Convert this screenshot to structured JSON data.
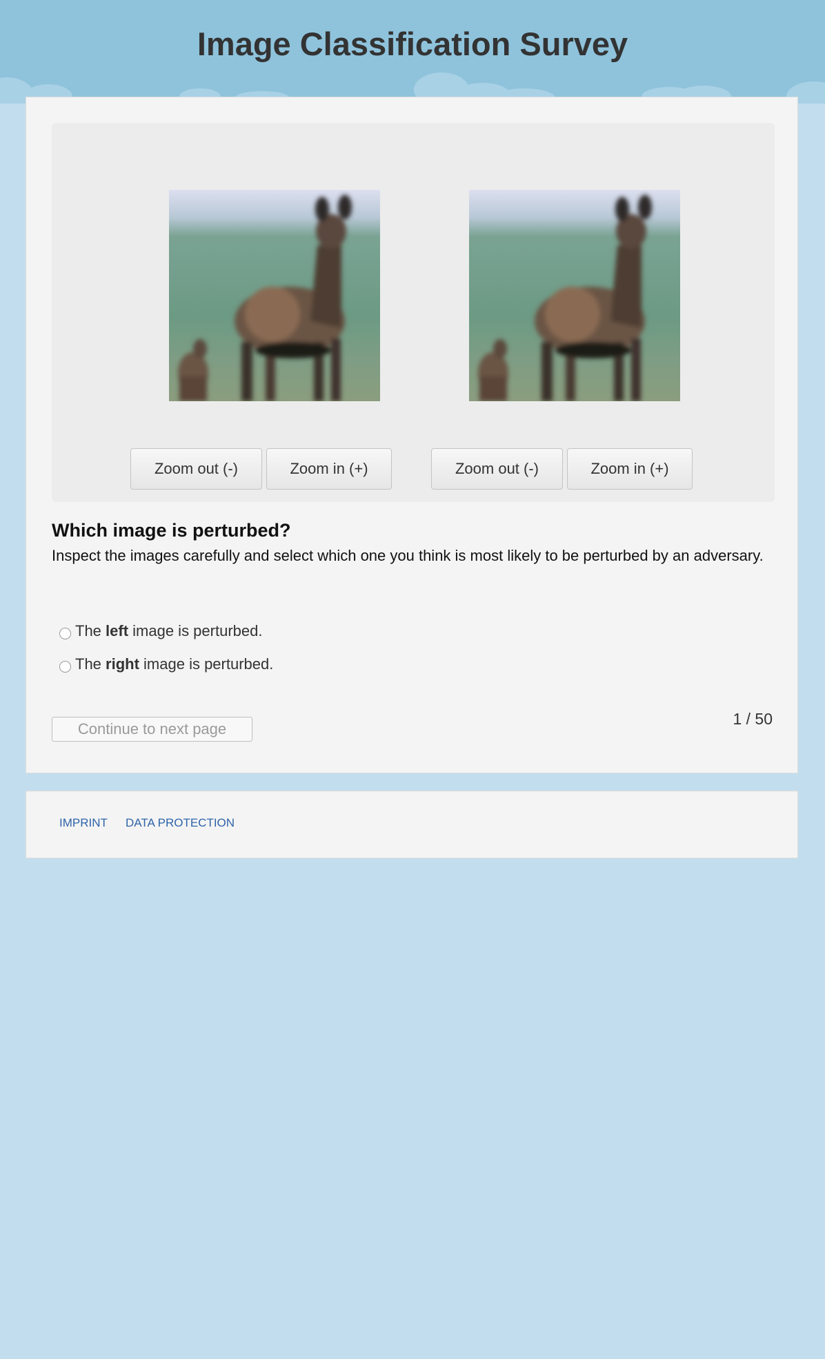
{
  "header": {
    "title": "Image Classification Survey"
  },
  "images": {
    "left_alt": "deer image (left)",
    "right_alt": "deer image (right)"
  },
  "zoom_controls": {
    "left": {
      "zoom_out": "Zoom out (-)",
      "zoom_in": "Zoom in (+)"
    },
    "right": {
      "zoom_out": "Zoom out (-)",
      "zoom_in": "Zoom in (+)"
    }
  },
  "question": {
    "title": "Which image is perturbed?",
    "description": "Inspect the images carefully and select which one you think is most likely to be perturbed by an adversary.",
    "options": [
      {
        "prefix": "The ",
        "emphasis": "left",
        "suffix": " image is perturbed.",
        "selected": false
      },
      {
        "prefix": "The ",
        "emphasis": "right",
        "suffix": " image is perturbed.",
        "selected": false
      }
    ]
  },
  "navigation": {
    "continue_label": "Continue to next page",
    "continue_enabled": false,
    "progress": "1 / 50"
  },
  "footer": {
    "links": [
      "Imprint",
      "Data Protection"
    ]
  },
  "colors": {
    "page_background": "#c2deee",
    "header_background": "#8fc3dc",
    "card_background": "#f4f4f4",
    "link": "#2e63a8"
  }
}
